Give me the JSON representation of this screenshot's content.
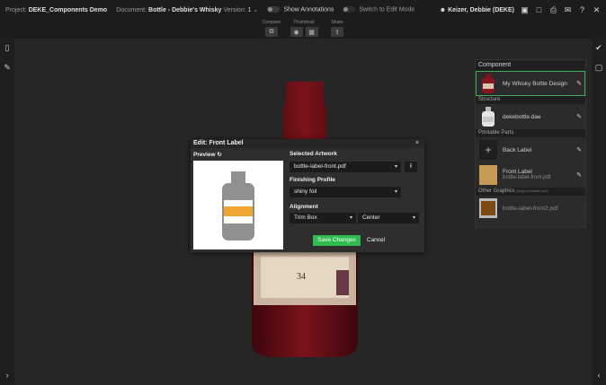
{
  "topbar": {
    "project_label": "Project:",
    "project_name": "DEKE_Components Demo",
    "document_label": "Document:",
    "document_name": "Bottle - Debbie's Whisky",
    "version_label": "Version:",
    "version_value": "1",
    "show_annotations": "Show Annotations",
    "switch_edit": "Switch to Edit Mode",
    "user_name": "Keizer, Debbie (DEKE)"
  },
  "toolbar": {
    "compare_label": "Compare",
    "thumbnail_label": "Thumbnail",
    "share_label": "Share"
  },
  "panel": {
    "component_header": "Component",
    "component_name": "My Whisky Bottle Design",
    "structure_header": "Structure",
    "structure_name": "dekebottle.dae",
    "printable_header": "Printable Parts",
    "back_label": "Back Label",
    "front_label": "Front Label",
    "front_label_file": "bottle-label-front.pdf",
    "other_header": "Other Graphics",
    "other_hint": "(drag to printable part)",
    "other_file": "bottle-label-front2.pdf"
  },
  "dialog": {
    "title": "Edit: Front Label",
    "close": "×",
    "preview_label": "Preview",
    "artwork_label": "Selected Artwork",
    "artwork_value": "bottle-label-front.pdf",
    "finishing_label": "Finishing Profile",
    "finishing_value": "shiny foil",
    "alignment_label": "Alignment",
    "alignment_box": "Trim Box",
    "alignment_pos": "Center",
    "save_button": "Save Changes",
    "cancel_button": "Cancel"
  },
  "bottle_label": {
    "age": "34"
  },
  "colors": {
    "accent_green": "#2ebc4f",
    "bottle_red": "#6e1018",
    "preview_orange": "#f0a532",
    "preview_gray": "#8f8f8f"
  }
}
